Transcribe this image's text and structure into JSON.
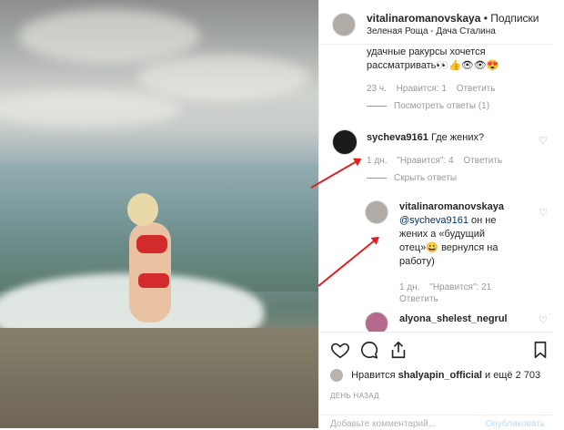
{
  "post": {
    "username": "vitalinaromanovskaya",
    "separator": "•",
    "follow_label": "Подписки",
    "location": "Зеленая Роща - Дача Сталина"
  },
  "comments": [
    {
      "text_lines": [
        "удачные ракурсы хочется",
        "рассматривать👀👍👁👁😍"
      ],
      "time": "23 ч.",
      "likes": "Нравится: 1",
      "reply": "Ответить",
      "view_replies": "Посмотреть ответы (1)"
    },
    {
      "username": "sycheva9161",
      "text": "Где жених?",
      "time": "1 дн.",
      "likes": "\"Нравится\": 4",
      "reply": "Ответить",
      "hide_replies": "Скрыть ответы"
    },
    {
      "username": "vitalinaromanovskaya",
      "mention": "@sycheva9161",
      "text_lines": [
        " он не",
        "жених а «будущий",
        "отец»😀 вернулся на",
        "работу)"
      ],
      "time": "1 дн.",
      "likes": "\"Нравится\": 21",
      "reply": "Ответить"
    },
    {
      "username": "alyona_shelest_negrul"
    }
  ],
  "actions": {
    "liked_by_prefix": "Нравится",
    "liked_by_user": "shalyapin_official",
    "liked_by_suffix": "и ещё 2 703",
    "time_ago": "ДЕНЬ НАЗАД",
    "comment_placeholder": "Добавьте комментарий...",
    "publish_label": "Опубликовать"
  },
  "icons": [
    "heart-icon",
    "comment-icon",
    "share-icon",
    "bookmark-icon"
  ],
  "colors": {
    "arrow": "#e02020",
    "link": "#003569",
    "meta": "#999999"
  }
}
